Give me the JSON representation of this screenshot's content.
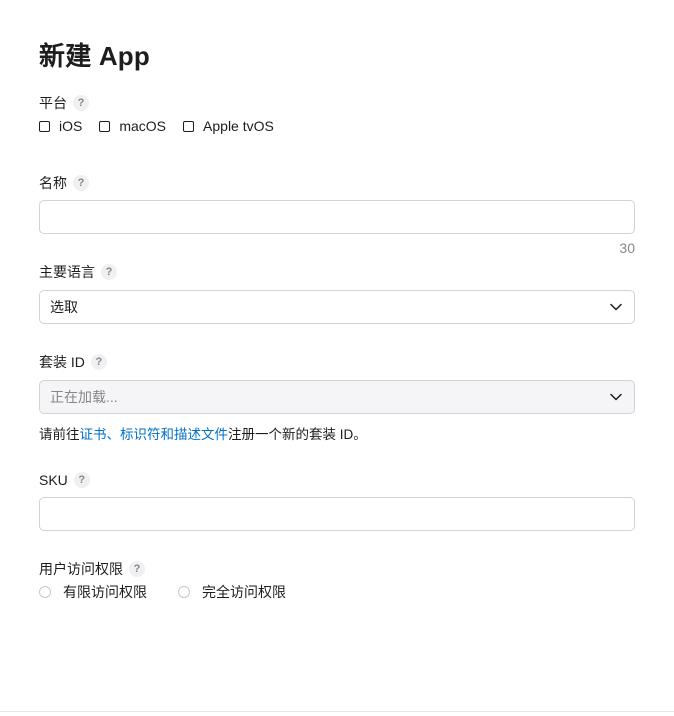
{
  "page": {
    "title": "新建 App"
  },
  "help_icon": "?",
  "platform": {
    "label": "平台",
    "options": [
      "iOS",
      "macOS",
      "Apple tvOS"
    ]
  },
  "name_field": {
    "label": "名称",
    "value": "",
    "placeholder": "",
    "counter": "30"
  },
  "primary_language": {
    "label": "主要语言",
    "selected": "选取"
  },
  "bundle_id": {
    "label": "套装 ID",
    "selected": "正在加载...",
    "note_prefix": "请前往",
    "note_link": "证书、标识符和描述文件",
    "note_suffix": "注册一个新的套装 ID。"
  },
  "sku": {
    "label": "SKU",
    "value": "",
    "placeholder": ""
  },
  "user_access": {
    "label": "用户访问权限",
    "options": [
      "有限访问权限",
      "完全访问权限"
    ]
  },
  "colors": {
    "link": "#0070c9",
    "border": "#d2d2d7",
    "muted": "#86868b"
  }
}
